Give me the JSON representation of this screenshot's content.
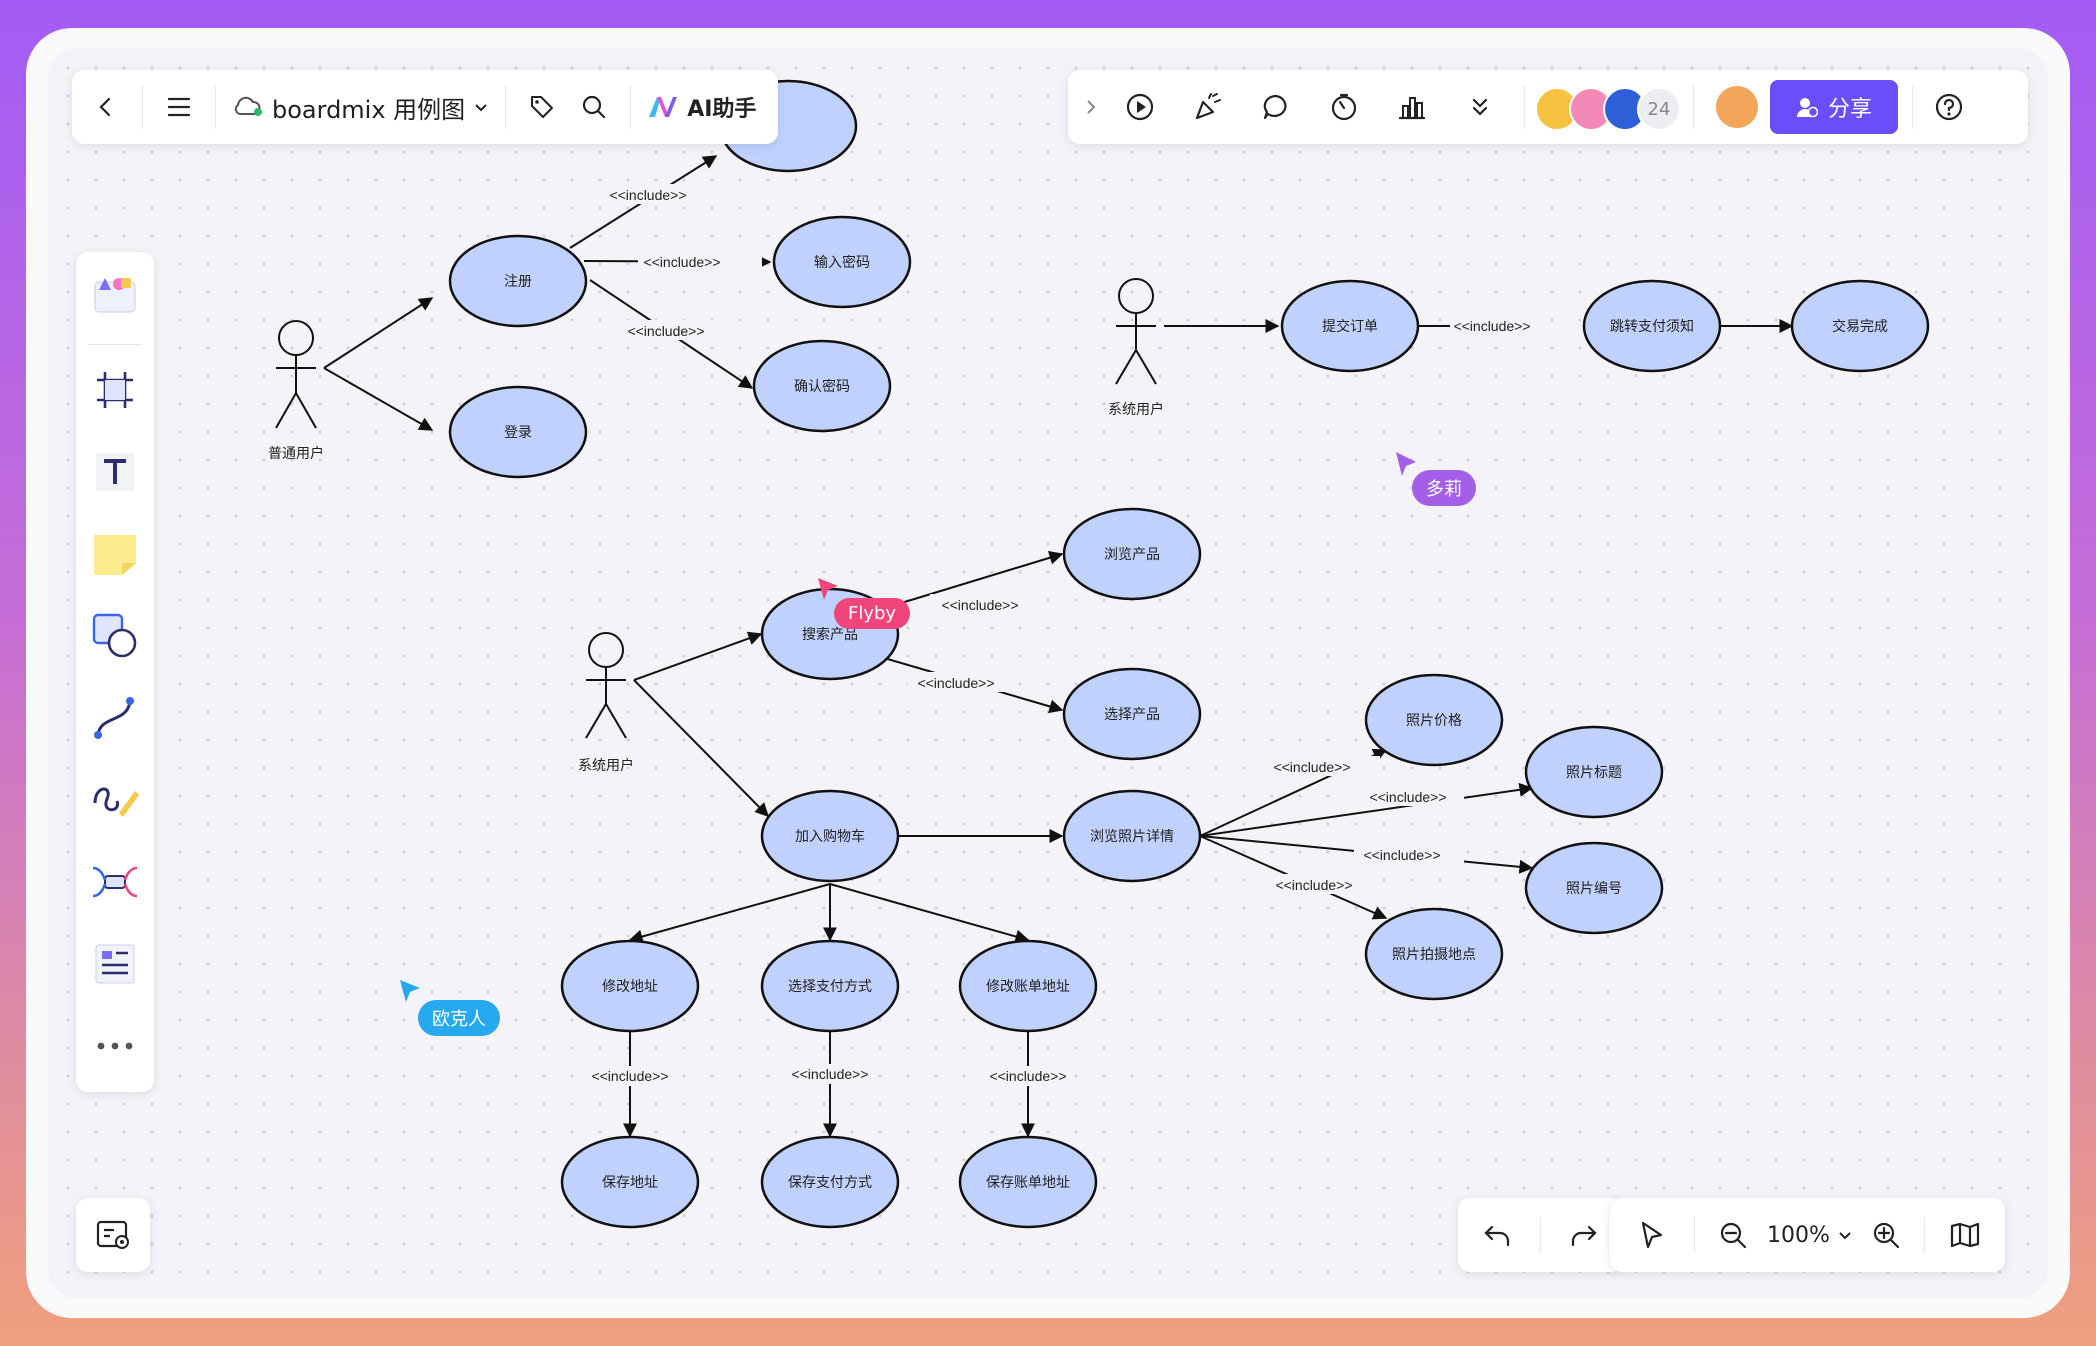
{
  "header": {
    "file_title": "boardmix 用例图",
    "ai_label": "AI助手",
    "collaborator_count": "24",
    "share_label": "分享"
  },
  "zoom": {
    "level": "100%"
  },
  "cursors": [
    {
      "name": "Flyby",
      "color": "#f0457a"
    },
    {
      "name": "多莉",
      "color": "#a45fe8"
    },
    {
      "name": "欧克人",
      "color": "#26a9ef"
    }
  ],
  "diagram": {
    "include_label": "<<include>>",
    "actors": {
      "normal_user": "普通用户",
      "system_user_a": "系统用户",
      "system_user_b": "系统用户"
    },
    "use_cases": {
      "register": "注册",
      "login": "登录",
      "input_password": "输入密码",
      "confirm_password": "确认密码",
      "submit_order": "提交订单",
      "jump_payment": "跳转支付须知",
      "trade_done": "交易完成",
      "browse_product": "浏览产品",
      "search_product": "搜索产品",
      "select_product": "选择产品",
      "add_cart": "加入购物车",
      "browse_photo": "浏览照片详情",
      "photo_price": "照片价格",
      "photo_title": "照片标题",
      "photo_number": "照片编号",
      "photo_location": "照片拍摄地点",
      "modify_address": "修改地址",
      "select_payment": "选择支付方式",
      "modify_billing": "修改账单地址",
      "save_address": "保存地址",
      "save_payment": "保存支付方式",
      "save_billing": "保存账单地址"
    }
  },
  "colors": {
    "ellipse_fill": "#c1d1fd",
    "brand": "#6a4dfb"
  }
}
